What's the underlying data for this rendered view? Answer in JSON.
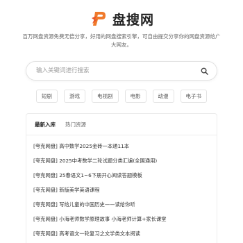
{
  "brand": {
    "title": "盘搜网",
    "logo_icon": "lightning-p-logo-icon",
    "accent_color": "#f07a2b"
  },
  "tagline": "百万网盘资源免费无偿分享，好用的网盘搜索引擎，可自由提交分享你的网盘资源给广大网友。",
  "search": {
    "placeholder": "输入关键词进行搜索",
    "value": "",
    "button_icon": "search-icon"
  },
  "tags": [
    {
      "label": "短剧"
    },
    {
      "label": "游戏"
    },
    {
      "label": "电视剧"
    },
    {
      "label": "电影"
    },
    {
      "label": "动漫"
    },
    {
      "label": "电子书"
    }
  ],
  "tabs": [
    {
      "label": "最新入库",
      "active": true
    },
    {
      "label": "热门资源",
      "active": false
    }
  ],
  "items": [
    {
      "title": "[夸克网盘] 高中数学2025金砖一本通11本"
    },
    {
      "title": "[夸克网盘] 2025中考数学二轮试题分类汇编(全国通用)"
    },
    {
      "title": "[夸克网盘] 25春语文1~6下册开心阅读答题模板"
    },
    {
      "title": "[夸克网盘] 新版美学英语课程"
    },
    {
      "title": "[夸克网盘] 写给儿童的中国历史——读给你听"
    },
    {
      "title": "[夸克网盘] 小海老师数学原理故事 小海老师计算+家长课堂"
    },
    {
      "title": "[夸克网盘] 高考语文一轮复习之文学类文本阅读"
    }
  ]
}
